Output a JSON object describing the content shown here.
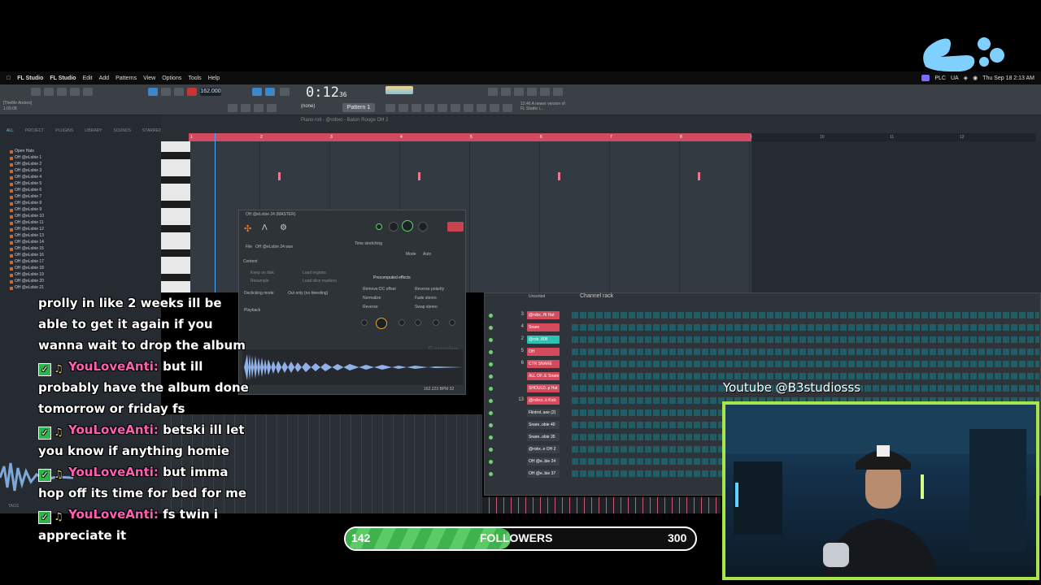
{
  "menubar": {
    "app": "FL Studio",
    "items": [
      "FL Studio",
      "Edit",
      "Add",
      "Patterns",
      "View",
      "Options",
      "Tools",
      "Help"
    ],
    "status_text": "PLC",
    "input_source": "UA",
    "datetime": "Thu Sep 18  2:13 AM"
  },
  "toolbar": {
    "tempo": "162.000",
    "time": "0:12",
    "time_frac": "36",
    "pattern": "Pattern 1",
    "channel_select": "(none)",
    "notice": "12:46 A newer version of FL Studio i...",
    "project_name": "[TheMe Anders]",
    "project_time": "1:05:08"
  },
  "browser": {
    "tabs": [
      "ALL",
      "PROJECT",
      "PLUGINS",
      "LIBRARY",
      "SOUNDS",
      "STARRED"
    ],
    "items": [
      "Open Hats",
      "OH  @eLobie 1",
      "OH  @eLobie 2",
      "OH  @eLobie 3",
      "OH  @eLobie 4",
      "OH  @eLobie 5",
      "OH  @eLobie 6",
      "OH  @eLobie 7",
      "OH  @eLobie 8",
      "OH  @eLobie 9",
      "OH  @eLobie 10",
      "OH  @eLobie 11",
      "OH  @eLobie 12",
      "OH  @eLobie 13",
      "OH  @eLobie 14",
      "OH  @eLobie 15",
      "OH  @eLobie 16",
      "OH  @eLobie 17",
      "OH  @eLobie 18",
      "OH  @eLobie 19",
      "OH  @eLobie 20",
      "OH  @eLobie 21"
    ],
    "tags_label": "TAGS"
  },
  "piano_roll": {
    "title": "Piano roll - @robxo - Baton Rouge OH 2",
    "bars": [
      "1",
      "2",
      "3",
      "4",
      "5",
      "6",
      "7",
      "8",
      "9",
      "10",
      "11",
      "12"
    ]
  },
  "sampler": {
    "title": "OH  @eLobie 24 (MASTER)",
    "file_label": "File",
    "file_name": "OH  @eLobie 24.wav",
    "section_content": "Content",
    "keep_on_disk": "Keep on disk",
    "resample": "Resample",
    "load_regions": "Load regions",
    "load_slice_markers": "Load slice markers",
    "declicking_label": "Declicking mode",
    "declicking_value": "Out only (no bleeding)",
    "playback": "Playback",
    "time_stretching": "Time stretching",
    "mode_label": "Mode",
    "mode_value": "Auto",
    "precomputed": "Precomputed effects",
    "effects": [
      "Remove DC offset",
      "Reverse polarity",
      "Normalize",
      "Fade stereo",
      "Reverse",
      "Swap stereo"
    ],
    "watermark": "Sampler",
    "bpm_readout": "162.223 BPM 32"
  },
  "channel_rack": {
    "title": "Channel rack",
    "filter": "Unsorted",
    "rows": [
      {
        "num": "3",
        "name": "@robx..Hi Hat",
        "color": "#d54a5c"
      },
      {
        "num": "4",
        "name": "Snare",
        "color": "#d54a5c"
      },
      {
        "num": "2",
        "name": "@rob..808",
        "color": "#2cc3b5"
      },
      {
        "num": "5",
        "name": "OH",
        "color": "#d54a5c"
      },
      {
        "num": "6",
        "name": "CTR SNARE",
        "color": "#d54a5c"
      },
      {
        "num": "",
        "name": "ALL OF..E Snare",
        "color": "#d54a5c"
      },
      {
        "num": "",
        "name": "SHOULD..p Hat",
        "color": "#d54a5c"
      },
      {
        "num": "13",
        "name": "@robxo..k Kick",
        "color": "#d54a5c"
      },
      {
        "num": "",
        "name": "Flintrol..axe (2)",
        "color": "#3a4047"
      },
      {
        "num": "",
        "name": "Snare..obie 40",
        "color": "#3a4047"
      },
      {
        "num": "",
        "name": "Snare..obie 35",
        "color": "#3a4047"
      },
      {
        "num": "",
        "name": "@robx..e OH 2",
        "color": "#3a4047"
      },
      {
        "num": "",
        "name": "OH  @e..bie 24",
        "color": "#3a4047"
      },
      {
        "num": "",
        "name": "OH  @e..bie 37",
        "color": "#3a4047"
      }
    ]
  },
  "chat": {
    "lines": [
      {
        "user": "",
        "text": "prolly in like 2 weeks ill be able to get it again if you wanna wait to drop the album"
      },
      {
        "user": "YouLoveAnti:",
        "text": "but ill probably have the album done tomorrow or friday fs"
      },
      {
        "user": "YouLoveAnti:",
        "text": "betski ill let you know if anything homie"
      },
      {
        "user": "YouLoveAnti:",
        "text": "but imma hop off its time for bed for me"
      },
      {
        "user": "YouLoveAnti:",
        "text": "fs twin i appreciate it"
      }
    ]
  },
  "followers": {
    "current": "142",
    "label": "FOLLOWERS",
    "goal": "300",
    "progress_fraction": 0.473
  },
  "webcam": {
    "caption": "Youtube @B3studiosss"
  },
  "colors": {
    "accent_green": "#a6e64a",
    "chat_user": "#ff5fb3",
    "pattern_red": "#d24a60"
  }
}
